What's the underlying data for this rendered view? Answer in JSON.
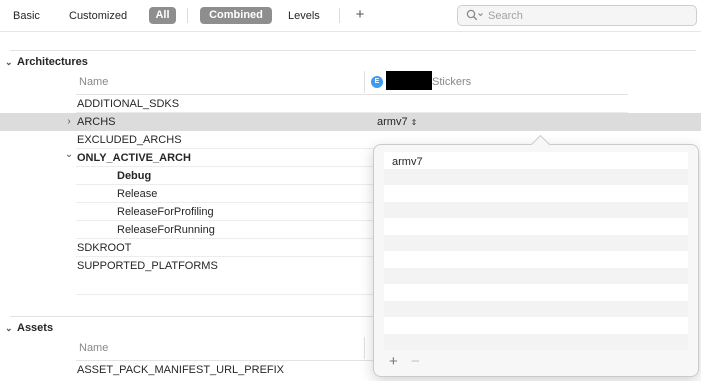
{
  "toolbar": {
    "basic": "Basic",
    "customized": "Customized",
    "all": "All",
    "combined": "Combined",
    "levels": "Levels",
    "add": "+",
    "search_placeholder": "Search"
  },
  "architectures": {
    "title": "Architectures",
    "name_header": "Name",
    "target_header_suffix": "Stickers",
    "target_icon": "E",
    "rows": [
      {
        "label": "ADDITIONAL_SDKS",
        "value": ""
      },
      {
        "label": "ARCHS",
        "value": "armv7",
        "disclosure": "›"
      },
      {
        "label": "EXCLUDED_ARCHS",
        "value": ""
      },
      {
        "label": "ONLY_ACTIVE_ARCH",
        "value": "",
        "disclosure": "⌄"
      },
      {
        "label": "Debug",
        "value": ""
      },
      {
        "label": "Release",
        "value": ""
      },
      {
        "label": "ReleaseForProfiling",
        "value": ""
      },
      {
        "label": "ReleaseForRunning",
        "value": ""
      },
      {
        "label": "SDKROOT",
        "value": ""
      },
      {
        "label": "SUPPORTED_PLATFORMS",
        "value": ""
      }
    ]
  },
  "assets": {
    "title": "Assets",
    "name_header": "Name",
    "rows": [
      {
        "label": "ASSET_PACK_MANIFEST_URL_PREFIX"
      }
    ]
  },
  "popover": {
    "items": [
      "armv7"
    ],
    "add": "+",
    "remove": "−"
  },
  "icons": {
    "search": "magnifier-icon",
    "disclosure": "triangle-icon"
  },
  "colors": {
    "selected_row": "#dcdcdc",
    "pill": "#8e8e8e",
    "target_icon": "#3d9bf5"
  }
}
